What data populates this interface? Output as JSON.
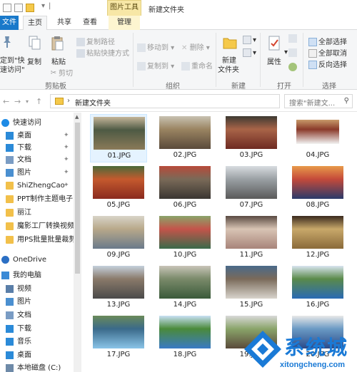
{
  "window": {
    "title": "新建文件夹",
    "tools_tab": "图片工具"
  },
  "tabs": {
    "file": "文件",
    "home": "主页",
    "share": "共享",
    "view": "查看",
    "manage": "管理"
  },
  "ribbon": {
    "clipboard": {
      "pin_label_1": "定到\"快",
      "pin_label_2": "速访问\"",
      "copy": "复制",
      "paste": "粘贴",
      "copy_path": "复制路径",
      "paste_shortcut": "粘贴快捷方式",
      "cut": "剪切",
      "group": "剪贴板"
    },
    "organize": {
      "move_to": "移动到",
      "copy_to": "复制到",
      "delete": "删除",
      "rename": "重命名",
      "group": "组织"
    },
    "new": {
      "new_folder_1": "新建",
      "new_folder_2": "文件夹",
      "group": "新建"
    },
    "open": {
      "properties": "属性",
      "group": "打开"
    },
    "select": {
      "select_all": "全部选择",
      "select_none": "全部取消",
      "invert": "反向选择",
      "group": "选择"
    }
  },
  "address": {
    "path": "新建文件夹",
    "search_placeholder": "搜索\"新建文..."
  },
  "nav": {
    "items": [
      {
        "label": "快速访问",
        "icon": "star-icon",
        "color": "#1e8be6",
        "indent": 0
      },
      {
        "label": "桌面",
        "icon": "desktop-icon",
        "color": "#2b8ad8",
        "indent": 1,
        "pinned": true
      },
      {
        "label": "下载",
        "icon": "download-icon",
        "color": "#2b8ad8",
        "indent": 1,
        "pinned": true
      },
      {
        "label": "文档",
        "icon": "document-icon",
        "color": "#7a9cc4",
        "indent": 1,
        "pinned": true
      },
      {
        "label": "图片",
        "icon": "pictures-icon",
        "color": "#4a8fd0",
        "indent": 1,
        "pinned": true
      },
      {
        "label": "ShiZhengCao",
        "icon": "folder-icon",
        "color": "#f2c04a",
        "indent": 1,
        "pinned": true
      },
      {
        "label": "PPT制作主题电子!",
        "icon": "folder-icon",
        "color": "#f2c04a",
        "indent": 1
      },
      {
        "label": "丽江",
        "icon": "folder-icon",
        "color": "#f2c04a",
        "indent": 1
      },
      {
        "label": "魔影工厂转换视频",
        "icon": "folder-icon",
        "color": "#f2c04a",
        "indent": 1
      },
      {
        "label": "用PS批量批量裁剪",
        "icon": "folder-icon",
        "color": "#f2c04a",
        "indent": 1
      },
      {
        "label": "OneDrive",
        "icon": "cloud-icon",
        "color": "#2b6fc4",
        "indent": 0
      },
      {
        "label": "我的电脑",
        "icon": "computer-icon",
        "color": "#3a8ad6",
        "indent": 0
      },
      {
        "label": "视频",
        "icon": "video-icon",
        "color": "#5a7ea8",
        "indent": 1
      },
      {
        "label": "图片",
        "icon": "pictures-icon",
        "color": "#4a8fd0",
        "indent": 1
      },
      {
        "label": "文档",
        "icon": "document-icon",
        "color": "#7a9cc4",
        "indent": 1
      },
      {
        "label": "下载",
        "icon": "download-icon",
        "color": "#2b8ad8",
        "indent": 1
      },
      {
        "label": "音乐",
        "icon": "music-icon",
        "color": "#2b8ad8",
        "indent": 1
      },
      {
        "label": "桌面",
        "icon": "desktop-icon",
        "color": "#2b8ad8",
        "indent": 1
      },
      {
        "label": "本地磁盘 (C:)",
        "icon": "drive-icon",
        "color": "#6e8aa8",
        "indent": 1
      }
    ]
  },
  "files": [
    {
      "name": "01.JPG",
      "colors": [
        "#8a7a58",
        "#4e5a44",
        "#c4b69a"
      ],
      "selected": true
    },
    {
      "name": "02.JPG",
      "colors": [
        "#5a4a3a",
        "#9a8462",
        "#c8c2b2"
      ]
    },
    {
      "name": "03.JPG",
      "colors": [
        "#6e2a22",
        "#a86448",
        "#3e3a32"
      ]
    },
    {
      "name": "04.JPG",
      "colors": [
        "#f2f2f2",
        "#8a3a2a",
        "#c89a6a"
      ],
      "small": true
    },
    {
      "name": "05.JPG",
      "colors": [
        "#8a2a1e",
        "#c45a2e",
        "#4a6a3a"
      ]
    },
    {
      "name": "06.JPG",
      "colors": [
        "#3a3632",
        "#7a6a58",
        "#b84a3a"
      ]
    },
    {
      "name": "07.JPG",
      "colors": [
        "#5a5a5a",
        "#9aa0a4",
        "#d8dce0"
      ]
    },
    {
      "name": "08.JPG",
      "colors": [
        "#2a3a6a",
        "#c44a3a",
        "#e89a4a"
      ]
    },
    {
      "name": "09.JPG",
      "colors": [
        "#6a7a8a",
        "#b8a88a",
        "#d8d4c8"
      ]
    },
    {
      "name": "10.JPG",
      "colors": [
        "#3a6a4a",
        "#c4544a",
        "#8aa46a"
      ]
    },
    {
      "name": "11.JPG",
      "colors": [
        "#a8847a",
        "#d8c4b4",
        "#5a4a42"
      ]
    },
    {
      "name": "12.JPG",
      "colors": [
        "#8a6a3a",
        "#c8a86a",
        "#3a2a1e"
      ]
    },
    {
      "name": "13.JPG",
      "colors": [
        "#4a4a4a",
        "#8a7a6a",
        "#c4d0dc"
      ]
    },
    {
      "name": "14.JPG",
      "colors": [
        "#3a5a3a",
        "#7a8a6a",
        "#c8c4b8"
      ]
    },
    {
      "name": "15.JPG",
      "colors": [
        "#d8d4cc",
        "#7a6a5a",
        "#4a6a8a"
      ]
    },
    {
      "name": "16.JPG",
      "colors": [
        "#2a6ab4",
        "#5a8a4a",
        "#d8e4f0"
      ]
    },
    {
      "name": "17.JPG",
      "colors": [
        "#8ac4e8",
        "#3a6a8a",
        "#6a8a5a"
      ]
    },
    {
      "name": "18.JPG",
      "colors": [
        "#3a7ac4",
        "#4a8a3a",
        "#c8e0f4"
      ]
    },
    {
      "name": "19.JPG",
      "colors": [
        "#5a4a3a",
        "#8aa46a",
        "#d8d8d8"
      ]
    },
    {
      "name": "20.JPG",
      "colors": [
        "#2a4a8a",
        "#6a9ac4",
        "#e8e8e8"
      ]
    }
  ],
  "watermark": {
    "text": "系统城",
    "url": "xitongcheng.com"
  },
  "colors": {
    "accent": "#1979ca",
    "selection": "#cce8ff",
    "tools_tab": "#f7e7a6"
  }
}
